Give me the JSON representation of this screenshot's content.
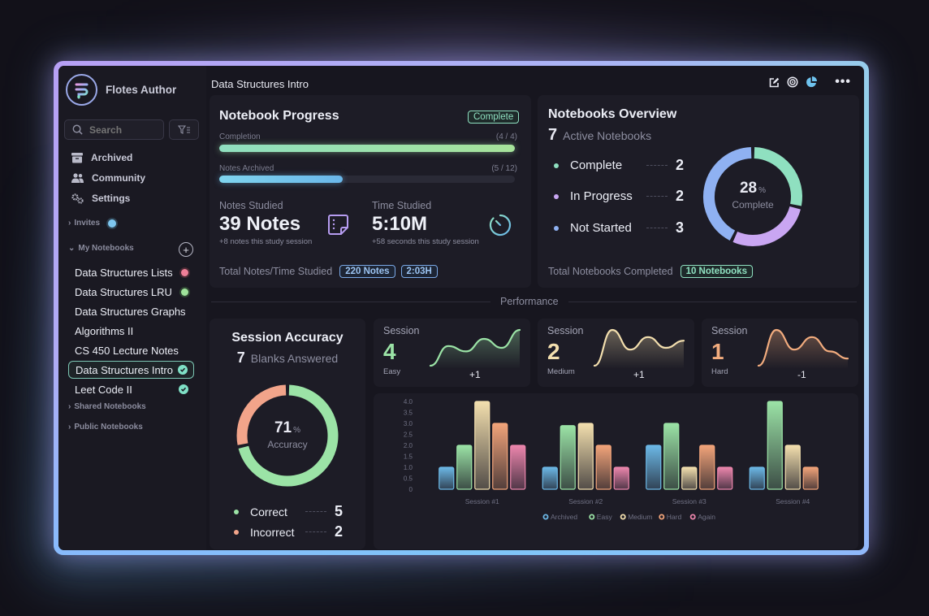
{
  "app": {
    "name": "Flotes Author"
  },
  "sidebar": {
    "search_placeholder": "Search",
    "nav": [
      {
        "label": "Archived",
        "icon": "archive-icon"
      },
      {
        "label": "Community",
        "icon": "users-icon"
      },
      {
        "label": "Settings",
        "icon": "gears-icon"
      }
    ],
    "invites_label": "Invites",
    "my_notebooks_label": "My Notebooks",
    "notebooks": [
      {
        "label": "Data Structures Lists",
        "status": "red-dot"
      },
      {
        "label": "Data Structures LRU",
        "status": "green-dot"
      },
      {
        "label": "Data Structures Graphs",
        "status": ""
      },
      {
        "label": "Algorithms II",
        "status": ""
      },
      {
        "label": "CS 450 Lecture Notes",
        "status": ""
      },
      {
        "label": "Data Structures Intro",
        "status": "check",
        "selected": true
      },
      {
        "label": "Leet Code II",
        "status": "check"
      }
    ],
    "shared_label": "Shared Notebooks",
    "public_label": "Public Notebooks"
  },
  "header": {
    "title": "Data Structures Intro",
    "icons": [
      "edit-icon",
      "target-icon",
      "pie-chart-icon",
      "more-icon"
    ]
  },
  "progress": {
    "title": "Notebook Progress",
    "badge": "Complete",
    "completion_label": "Completion",
    "completion_count": "(4 / 4)",
    "completion_fraction": 1.0,
    "archived_label": "Notes Archived",
    "archived_count": "(5 / 12)",
    "archived_fraction": 0.4167,
    "notes_label": "Notes Studied",
    "notes_value": "39 Notes",
    "notes_sub": "+8 notes this study session",
    "time_label": "Time Studied",
    "time_value": "5:10M",
    "time_sub": "+58 seconds this study session",
    "total_label": "Total Notes/Time Studied",
    "total_notes": "220 Notes",
    "total_time": "2:03H"
  },
  "overview": {
    "title": "Notebooks Overview",
    "active_count": "7",
    "active_label": "Active Notebooks",
    "items": [
      {
        "label": "Complete",
        "value": "2",
        "color": "#8fe0c0"
      },
      {
        "label": "In Progress",
        "value": "2",
        "color": "#c9a6f2"
      },
      {
        "label": "Not Started",
        "value": "3",
        "color": "#8fb1f2"
      }
    ],
    "percent": "28",
    "percent_sign": "%",
    "percent_label": "Complete",
    "total_label": "Total Notebooks Completed",
    "total_value": "10 Notebooks"
  },
  "performance_label": "Performance",
  "accuracy": {
    "title": "Session Accuracy",
    "count": "7",
    "count_label": "Blanks Answered",
    "percent": "71",
    "percent_sign": "%",
    "percent_label": "Accuracy",
    "items": [
      {
        "label": "Correct",
        "value": "5",
        "color": "#9be3a6"
      },
      {
        "label": "Incorrect",
        "value": "2",
        "color": "#f2a48a"
      }
    ]
  },
  "sessions": [
    {
      "label": "Session",
      "value": "4",
      "kind": "Easy",
      "delta": "+1",
      "color": "#9be3a6",
      "trend": [
        0,
        0.55,
        0.4,
        0.75,
        0.5,
        1
      ]
    },
    {
      "label": "Session",
      "value": "2",
      "kind": "Medium",
      "delta": "+1",
      "color": "#f3dfae",
      "trend": [
        0,
        1,
        0.45,
        0.8,
        0.5,
        0.7
      ]
    },
    {
      "label": "Session",
      "value": "1",
      "kind": "Hard",
      "delta": "-1",
      "color": "#f2ac7e",
      "trend": [
        0,
        1,
        0.45,
        0.8,
        0.4,
        0.2
      ]
    }
  ],
  "chart_data": {
    "type": "bar",
    "categories": [
      "Session #1",
      "Session #2",
      "Session #3",
      "Session #4"
    ],
    "series": [
      {
        "name": "Archived",
        "color": "#6cb8e6",
        "values": [
          1,
          1,
          2,
          1
        ]
      },
      {
        "name": "Easy",
        "color": "#9be3a6",
        "values": [
          2,
          2.9,
          3,
          4
        ]
      },
      {
        "name": "Medium",
        "color": "#f3dfae",
        "values": [
          4,
          3,
          1,
          2
        ]
      },
      {
        "name": "Hard",
        "color": "#f2a47a",
        "values": [
          3,
          2,
          2,
          1
        ]
      },
      {
        "name": "Again",
        "color": "#ec86ad",
        "values": [
          2,
          1,
          1,
          0
        ]
      }
    ],
    "yticks": [
      "0",
      "0.5",
      "1.0",
      "1.5",
      "2.0",
      "2.5",
      "3.0",
      "3.5",
      "4.0"
    ],
    "ylim": [
      0,
      4
    ],
    "legend": "bottom",
    "grid": false
  }
}
